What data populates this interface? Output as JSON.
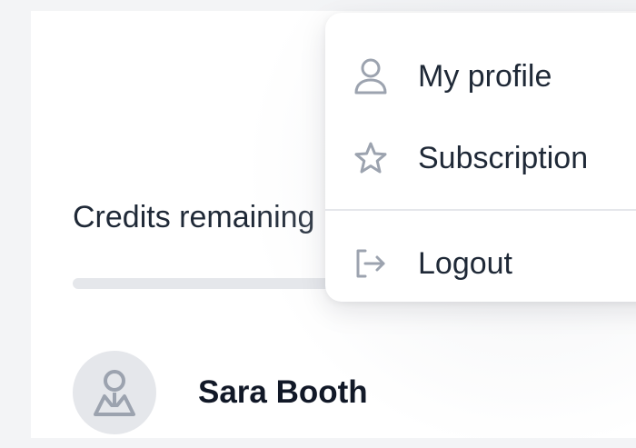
{
  "account_panel": {
    "credits_label": "Credits remaining",
    "credits_bar_fill_fraction": null,
    "user": {
      "name": "Sara Booth"
    }
  },
  "user_menu": {
    "items": [
      {
        "label": "My profile",
        "icon": "user-icon"
      },
      {
        "label": "Subscription",
        "icon": "star-icon"
      },
      {
        "label": "Logout",
        "icon": "logout-icon"
      }
    ]
  },
  "colors": {
    "background": "#f3f4f6",
    "surface": "#ffffff",
    "text_primary": "#111827",
    "icon_gray": "#9ca3af",
    "divider": "#e5e7eb"
  }
}
